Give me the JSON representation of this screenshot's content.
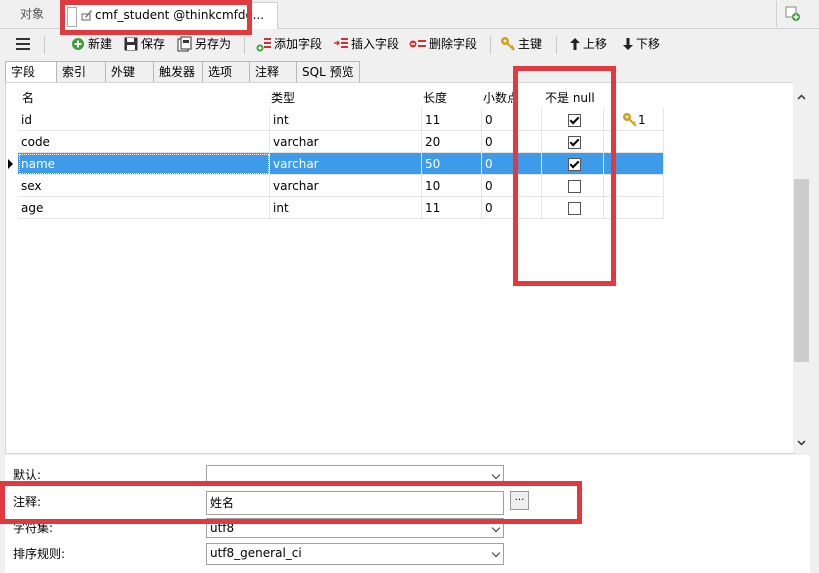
{
  "tabs": {
    "objects": "对象",
    "active": "cmf_student @thinkcmfdo..."
  },
  "toolbar": {
    "new": "新建",
    "save": "保存",
    "save_as": "另存为",
    "add_field": "添加字段",
    "insert_field": "插入字段",
    "delete_field": "删除字段",
    "primary_key": "主键",
    "move_up": "上移",
    "move_down": "下移"
  },
  "subtabs": [
    "字段",
    "索引",
    "外键",
    "触发器",
    "选项",
    "注释",
    "SQL 预览"
  ],
  "grid": {
    "headers": {
      "name": "名",
      "type": "类型",
      "length": "长度",
      "decimal": "小数点",
      "not_null": "不是 null"
    },
    "rows": [
      {
        "name": "id",
        "type": "int",
        "length": "11",
        "decimal": "0",
        "not_null": true,
        "key": "1"
      },
      {
        "name": "code",
        "type": "varchar",
        "length": "20",
        "decimal": "0",
        "not_null": true,
        "key": ""
      },
      {
        "name": "name",
        "type": "varchar",
        "length": "50",
        "decimal": "0",
        "not_null": true,
        "key": ""
      },
      {
        "name": "sex",
        "type": "varchar",
        "length": "10",
        "decimal": "0",
        "not_null": false,
        "key": ""
      },
      {
        "name": "age",
        "type": "int",
        "length": "11",
        "decimal": "0",
        "not_null": false,
        "key": ""
      }
    ],
    "selected_row": 2
  },
  "props": {
    "default_label": "默认:",
    "default_value": "",
    "comment_label": "注释:",
    "comment_value": "姓名",
    "comment_button": "...",
    "charset_label": "字符集:",
    "charset_value": "utf8",
    "collation_label": "排序规则:",
    "collation_value": "utf8_general_ci"
  },
  "colors": {
    "selection": "#3d9be9",
    "annotation": "#e0393e",
    "key": "#d4a017"
  }
}
